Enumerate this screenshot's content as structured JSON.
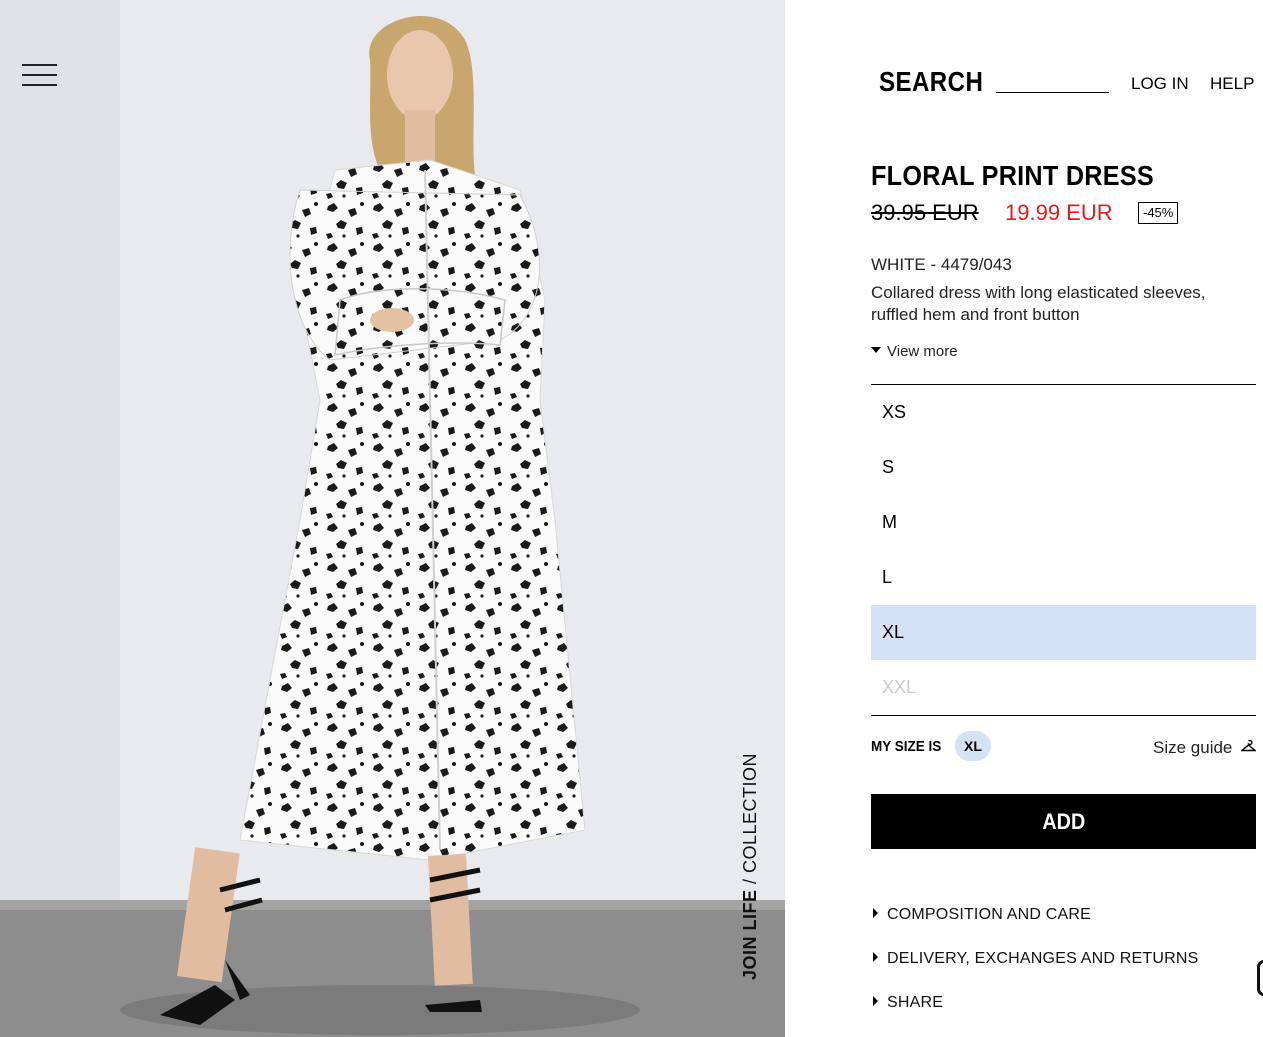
{
  "nav": {
    "search_label": "SEARCH",
    "login_label": "LOG IN",
    "help_label": "HELP"
  },
  "image_caption": {
    "bold": "JOIN LIFE",
    "rest": " / COLLECTION"
  },
  "product": {
    "title": "FLORAL PRINT DRESS",
    "old_price": "39.95 EUR",
    "new_price": "19.99 EUR",
    "discount": "-45%",
    "color_ref": "WHITE - 4479/043",
    "description": "Collared dress with long elasticated sleeves, ruffled hem and front button",
    "view_more": "View more"
  },
  "sizes": [
    {
      "label": "XS",
      "state": "available"
    },
    {
      "label": "S",
      "state": "available"
    },
    {
      "label": "M",
      "state": "available"
    },
    {
      "label": "L",
      "state": "available"
    },
    {
      "label": "XL",
      "state": "selected"
    },
    {
      "label": "XXL",
      "state": "unavailable"
    }
  ],
  "my_size": {
    "label": "MY SIZE IS",
    "value": "XL"
  },
  "size_guide": {
    "label": "Size guide",
    "icon": "hanger-icon"
  },
  "add_button_label": "ADD",
  "accordions": [
    {
      "label": "COMPOSITION AND CARE"
    },
    {
      "label": "DELIVERY, EXCHANGES AND RETURNS"
    },
    {
      "label": "SHARE"
    }
  ],
  "colors": {
    "sale_price": "#e51b1b",
    "selected_size_bg": "#d3e3f5",
    "add_button_bg": "#000000"
  }
}
